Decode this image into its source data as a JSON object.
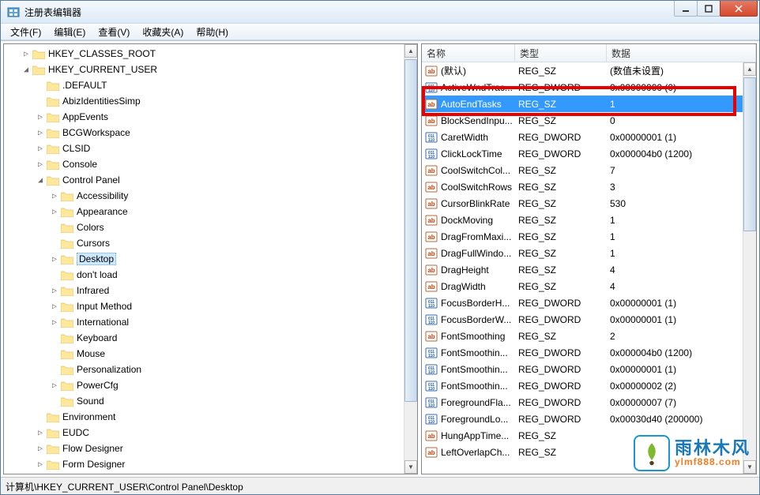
{
  "window": {
    "title": "注册表编辑器"
  },
  "menu": {
    "file": "文件(F)",
    "edit": "编辑(E)",
    "view": "查看(V)",
    "fav": "收藏夹(A)",
    "help": "帮助(H)"
  },
  "tree": [
    {
      "label": "HKEY_CLASSES_ROOT",
      "level": 1,
      "exp": "▷",
      "icon": "folder"
    },
    {
      "label": "HKEY_CURRENT_USER",
      "level": 1,
      "exp": "◢",
      "icon": "folder"
    },
    {
      "label": ".DEFAULT",
      "level": 2,
      "exp": "",
      "icon": "folder"
    },
    {
      "label": "AbizIdentitiesSimp",
      "level": 2,
      "exp": "",
      "icon": "folder"
    },
    {
      "label": "AppEvents",
      "level": 2,
      "exp": "▷",
      "icon": "folder"
    },
    {
      "label": "BCGWorkspace",
      "level": 2,
      "exp": "▷",
      "icon": "folder"
    },
    {
      "label": "CLSID",
      "level": 2,
      "exp": "▷",
      "icon": "folder"
    },
    {
      "label": "Console",
      "level": 2,
      "exp": "▷",
      "icon": "folder"
    },
    {
      "label": "Control Panel",
      "level": 2,
      "exp": "◢",
      "icon": "folder"
    },
    {
      "label": "Accessibility",
      "level": 3,
      "exp": "▷",
      "icon": "folder"
    },
    {
      "label": "Appearance",
      "level": 3,
      "exp": "▷",
      "icon": "folder"
    },
    {
      "label": "Colors",
      "level": 3,
      "exp": "",
      "icon": "folder"
    },
    {
      "label": "Cursors",
      "level": 3,
      "exp": "",
      "icon": "folder"
    },
    {
      "label": "Desktop",
      "level": 3,
      "exp": "▷",
      "icon": "folder",
      "sel": true
    },
    {
      "label": "don't load",
      "level": 3,
      "exp": "",
      "icon": "folder"
    },
    {
      "label": "Infrared",
      "level": 3,
      "exp": "▷",
      "icon": "folder"
    },
    {
      "label": "Input Method",
      "level": 3,
      "exp": "▷",
      "icon": "folder"
    },
    {
      "label": "International",
      "level": 3,
      "exp": "▷",
      "icon": "folder"
    },
    {
      "label": "Keyboard",
      "level": 3,
      "exp": "",
      "icon": "folder"
    },
    {
      "label": "Mouse",
      "level": 3,
      "exp": "",
      "icon": "folder"
    },
    {
      "label": "Personalization",
      "level": 3,
      "exp": "",
      "icon": "folder"
    },
    {
      "label": "PowerCfg",
      "level": 3,
      "exp": "▷",
      "icon": "folder"
    },
    {
      "label": "Sound",
      "level": 3,
      "exp": "",
      "icon": "folder"
    },
    {
      "label": "Environment",
      "level": 2,
      "exp": "",
      "icon": "folder"
    },
    {
      "label": "EUDC",
      "level": 2,
      "exp": "▷",
      "icon": "folder"
    },
    {
      "label": "Flow Designer",
      "level": 2,
      "exp": "▷",
      "icon": "folder"
    },
    {
      "label": "Form Designer",
      "level": 2,
      "exp": "▷",
      "icon": "folder"
    }
  ],
  "cols": {
    "name": "名称",
    "type": "类型",
    "data": "数据"
  },
  "rows": [
    {
      "name": "(默认)",
      "type": "REG_SZ",
      "data": "(数值未设置)",
      "kind": "sz"
    },
    {
      "name": "ActiveWndTrac...",
      "type": "REG_DWORD",
      "data": "0x00000000 (0)",
      "kind": "dw"
    },
    {
      "name": "AutoEndTasks",
      "type": "REG_SZ",
      "data": "1",
      "kind": "sz",
      "sel": true,
      "hi": true
    },
    {
      "name": "BlockSendInpu...",
      "type": "REG_SZ",
      "data": "0",
      "kind": "sz"
    },
    {
      "name": "CaretWidth",
      "type": "REG_DWORD",
      "data": "0x00000001 (1)",
      "kind": "dw"
    },
    {
      "name": "ClickLockTime",
      "type": "REG_DWORD",
      "data": "0x000004b0 (1200)",
      "kind": "dw"
    },
    {
      "name": "CoolSwitchCol...",
      "type": "REG_SZ",
      "data": "7",
      "kind": "sz"
    },
    {
      "name": "CoolSwitchRows",
      "type": "REG_SZ",
      "data": "3",
      "kind": "sz"
    },
    {
      "name": "CursorBlinkRate",
      "type": "REG_SZ",
      "data": "530",
      "kind": "sz"
    },
    {
      "name": "DockMoving",
      "type": "REG_SZ",
      "data": "1",
      "kind": "sz"
    },
    {
      "name": "DragFromMaxi...",
      "type": "REG_SZ",
      "data": "1",
      "kind": "sz"
    },
    {
      "name": "DragFullWindo...",
      "type": "REG_SZ",
      "data": "1",
      "kind": "sz"
    },
    {
      "name": "DragHeight",
      "type": "REG_SZ",
      "data": "4",
      "kind": "sz"
    },
    {
      "name": "DragWidth",
      "type": "REG_SZ",
      "data": "4",
      "kind": "sz"
    },
    {
      "name": "FocusBorderH...",
      "type": "REG_DWORD",
      "data": "0x00000001 (1)",
      "kind": "dw"
    },
    {
      "name": "FocusBorderW...",
      "type": "REG_DWORD",
      "data": "0x00000001 (1)",
      "kind": "dw"
    },
    {
      "name": "FontSmoothing",
      "type": "REG_SZ",
      "data": "2",
      "kind": "sz"
    },
    {
      "name": "FontSmoothin...",
      "type": "REG_DWORD",
      "data": "0x000004b0 (1200)",
      "kind": "dw"
    },
    {
      "name": "FontSmoothin...",
      "type": "REG_DWORD",
      "data": "0x00000001 (1)",
      "kind": "dw"
    },
    {
      "name": "FontSmoothin...",
      "type": "REG_DWORD",
      "data": "0x00000002 (2)",
      "kind": "dw"
    },
    {
      "name": "ForegroundFla...",
      "type": "REG_DWORD",
      "data": "0x00000007 (7)",
      "kind": "dw"
    },
    {
      "name": "ForegroundLo...",
      "type": "REG_DWORD",
      "data": "0x00030d40 (200000)",
      "kind": "dw"
    },
    {
      "name": "HungAppTime...",
      "type": "REG_SZ",
      "data": "",
      "kind": "sz"
    },
    {
      "name": "LeftOverlapCh...",
      "type": "REG_SZ",
      "data": "",
      "kind": "sz"
    }
  ],
  "status": "计算机\\HKEY_CURRENT_USER\\Control Panel\\Desktop",
  "watermark": {
    "cn": "雨林木风",
    "en": "ylmf888.com"
  }
}
